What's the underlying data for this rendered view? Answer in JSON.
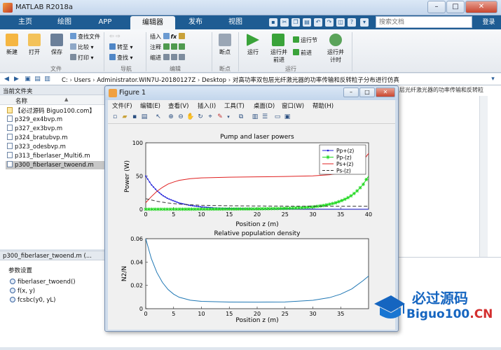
{
  "window": {
    "title": "MATLAB R2018a",
    "min": "–",
    "max": "□",
    "close": "✕"
  },
  "tabs": [
    {
      "label": "主页"
    },
    {
      "label": "绘图"
    },
    {
      "label": "APP"
    },
    {
      "label": "编辑器"
    },
    {
      "label": "发布"
    },
    {
      "label": "视图"
    }
  ],
  "search": {
    "placeholder": "搜索文档"
  },
  "signin": "登录",
  "ribbon": {
    "new": "新建",
    "open": "打开",
    "save": "保存",
    "find_files": "查找文件",
    "compare": "比较",
    "print": "打印",
    "goto": "转至",
    "find": "查找",
    "insert": "插入",
    "comment": "注释",
    "indent": "缩进",
    "breakpoint": "断点",
    "run": "运行",
    "run_advance": "运行并\n前进",
    "run_section": "运行节",
    "advance": "前进",
    "run_time": "运行并\n计时",
    "sections": {
      "file": "文件",
      "navigate": "导航",
      "edit": "编辑",
      "breakpoints": "断点",
      "run": "运行"
    },
    "fx_label": "fx"
  },
  "address": {
    "crumbs": [
      "C:",
      "Users",
      "Administrator.WIN7U-20180127Z",
      "Desktop",
      "对高功率双包层光纤激光器的功率传输和反转粒子分布进行仿真"
    ]
  },
  "left_panel": {
    "header": "当前文件夹",
    "column": "名称",
    "sort_arrow": "▲",
    "files": [
      "【必过源码 Biguo100.com】",
      "p329_ex4bvp.m",
      "p327_ex3bvp.m",
      "p324_bratubvp.m",
      "p323_odesbvp.m",
      "p313_fiberlaser_Multi6.m",
      "p300_fiberlaser_twoend.m"
    ],
    "selected": "p300_fiberlaser_twoend.m",
    "details_header": "p300_fiberlaser_twoend.m (...",
    "details_title": "参数设置",
    "functions": [
      "fiberlaser_twoend()",
      "f(x, y)",
      "fcsbc(y0, yL)"
    ]
  },
  "editor": {
    "tab_text": "层光纤激光器的功率传输和反转粒子分布进"
  },
  "figure": {
    "title": "Figure 1",
    "menu": [
      "文件(F)",
      "编辑(E)",
      "查看(V)",
      "插入(I)",
      "工具(T)",
      "桌面(D)",
      "窗口(W)",
      "帮助(H)"
    ]
  },
  "chart_data": [
    {
      "type": "line",
      "title": "Pump and laser powers",
      "xlabel": "Position z (m)",
      "ylabel": "Power (W)",
      "xlim": [
        0,
        40
      ],
      "ylim": [
        0,
        100
      ],
      "xticks": [
        0,
        5,
        10,
        15,
        20,
        25,
        30,
        35,
        40
      ],
      "yticks": [
        0,
        50,
        100
      ],
      "legend_position": "top-right",
      "grid": false,
      "series": [
        {
          "name": "Pp+(z)",
          "color": "#1f1fd8",
          "marker": "dot",
          "x": [
            0,
            1,
            2,
            3,
            4,
            6,
            8,
            10,
            12,
            15,
            20,
            25,
            30,
            35,
            40
          ],
          "y": [
            50,
            37,
            28,
            21,
            16,
            9.5,
            5.8,
            3.6,
            2.4,
            1.4,
            0.7,
            0.4,
            0.25,
            0.15,
            0.1
          ]
        },
        {
          "name": "Pp-(z)",
          "color": "#1fd81f",
          "marker": "star",
          "x": [
            0,
            5,
            10,
            15,
            20,
            25,
            28,
            30,
            32,
            34,
            35,
            36,
            37,
            38,
            39,
            40
          ],
          "y": [
            0.1,
            0.15,
            0.25,
            0.4,
            0.7,
            1.4,
            2.4,
            3.6,
            5.8,
            9.5,
            12.5,
            16,
            21,
            28,
            37,
            50
          ]
        },
        {
          "name": "Ps+(z)",
          "color": "#e02020",
          "marker": "none",
          "x": [
            0,
            1,
            2,
            3,
            4,
            5,
            6,
            8,
            10,
            15,
            20,
            25,
            30,
            33,
            35,
            36,
            37,
            38,
            39,
            40
          ],
          "y": [
            10,
            19,
            27,
            33,
            38,
            41,
            43.5,
            46,
            47.3,
            48.3,
            48.8,
            49.3,
            50.3,
            52,
            54.5,
            57,
            61,
            66,
            73,
            84
          ]
        },
        {
          "name": "Ps-(z)",
          "color": "#333333",
          "marker": "dash",
          "x": [
            0,
            2,
            4,
            6,
            8,
            10,
            15,
            20,
            25,
            30,
            35,
            40
          ],
          "y": [
            16,
            12,
            9.5,
            7.8,
            6.8,
            6.0,
            5.3,
            5.0,
            4.8,
            4.7,
            4.6,
            4.6
          ]
        }
      ]
    },
    {
      "type": "line",
      "title": "Relative population density",
      "xlabel": "Position z (m)",
      "ylabel": "N2/N",
      "xlim": [
        0,
        40
      ],
      "ylim": [
        0,
        0.06
      ],
      "xticks": [
        0,
        5,
        10,
        15,
        20,
        25,
        30,
        35
      ],
      "yticks": [
        0,
        0.02,
        0.04,
        0.06
      ],
      "grid": false,
      "series": [
        {
          "color": "#1f77b4",
          "x": [
            0,
            1,
            2,
            3,
            4,
            5,
            6,
            8,
            10,
            15,
            20,
            25,
            30,
            33,
            35,
            37,
            39,
            40
          ],
          "y": [
            0.06,
            0.043,
            0.031,
            0.0225,
            0.0165,
            0.0125,
            0.0098,
            0.0073,
            0.0063,
            0.0057,
            0.0056,
            0.0058,
            0.0072,
            0.0095,
            0.0125,
            0.017,
            0.024,
            0.028
          ]
        }
      ]
    }
  ],
  "watermark": {
    "cn": "必过源码",
    "en_a": "Biguo100",
    "en_b": ".CN"
  }
}
